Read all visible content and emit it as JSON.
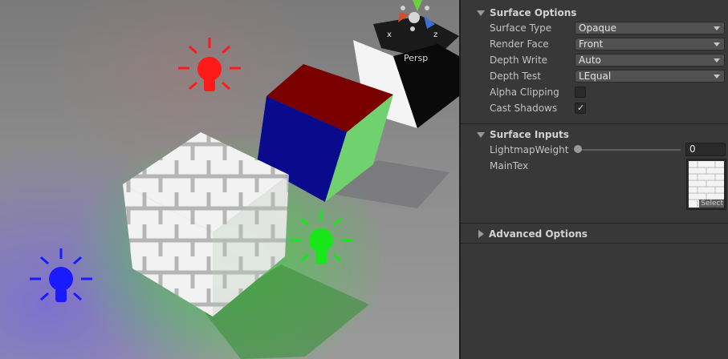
{
  "viewport": {
    "gizmo": {
      "x_label": "x",
      "z_label": "z",
      "projection": "Persp"
    },
    "light_icons": [
      {
        "name": "red-light",
        "color": "#ff1a1a"
      },
      {
        "name": "green-light",
        "color": "#19e619"
      },
      {
        "name": "blue-light",
        "color": "#1a1aff"
      }
    ]
  },
  "inspector": {
    "surface_options": {
      "title": "Surface Options",
      "surface_type": {
        "label": "Surface Type",
        "value": "Opaque"
      },
      "render_face": {
        "label": "Render Face",
        "value": "Front"
      },
      "depth_write": {
        "label": "Depth Write",
        "value": "Auto"
      },
      "depth_test": {
        "label": "Depth Test",
        "value": "LEqual"
      },
      "alpha_clipping": {
        "label": "Alpha Clipping",
        "checked": false
      },
      "cast_shadows": {
        "label": "Cast Shadows",
        "checked": true,
        "mark": "✓"
      }
    },
    "surface_inputs": {
      "title": "Surface Inputs",
      "lightmap_weight": {
        "label": "LightmapWeight",
        "value": "0",
        "slider_fraction": 0
      },
      "main_tex": {
        "label": "MainTex",
        "button": "Select"
      }
    },
    "advanced_options": {
      "title": "Advanced Options"
    }
  }
}
